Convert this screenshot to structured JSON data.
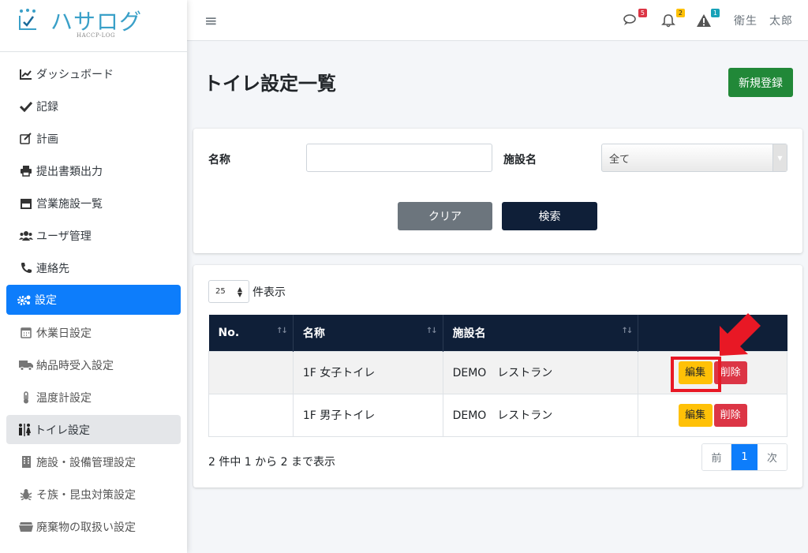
{
  "brand": {
    "name": "ハサログ",
    "sub": "HACCP-LOG"
  },
  "header": {
    "messages_badge": "5",
    "notifications_badge": "2",
    "alerts_badge": "1",
    "user_name": "衛生　太郎"
  },
  "sidebar": {
    "items": [
      {
        "label": "ダッシュボード",
        "icon": "chart-line-icon"
      },
      {
        "label": "記録",
        "icon": "check-icon"
      },
      {
        "label": "計画",
        "icon": "edit-icon"
      },
      {
        "label": "提出書類出力",
        "icon": "print-icon"
      },
      {
        "label": "営業施設一覧",
        "icon": "store-icon"
      },
      {
        "label": "ユーザ管理",
        "icon": "users-icon"
      },
      {
        "label": "連絡先",
        "icon": "phone-icon"
      },
      {
        "label": "設定",
        "icon": "cogs-icon"
      },
      {
        "label": "休業日設定",
        "icon": "calendar-icon"
      },
      {
        "label": "納品時受入設定",
        "icon": "truck-icon"
      },
      {
        "label": "温度計設定",
        "icon": "thermometer-icon"
      },
      {
        "label": "トイレ設定",
        "icon": "restroom-icon"
      },
      {
        "label": "施設・設備管理設定",
        "icon": "building-icon"
      },
      {
        "label": "そ族・昆虫対策設定",
        "icon": "bug-icon"
      },
      {
        "label": "廃棄物の取扱い設定",
        "icon": "dumpster-icon"
      }
    ]
  },
  "page": {
    "title": "トイレ設定一覧",
    "new_button": "新規登録"
  },
  "search": {
    "name_label": "名称",
    "name_value": "",
    "facility_label": "施設名",
    "facility_selected": "全て",
    "clear_button": "クリア",
    "search_button": "検索"
  },
  "list": {
    "page_length": "25",
    "page_length_label": "件表示",
    "columns": [
      "No.",
      "名称",
      "施設名",
      ""
    ],
    "rows": [
      {
        "no": "",
        "name": "1F 女子トイレ",
        "facility": "DEMO　レストラン",
        "edit": "編集",
        "delete": "削除"
      },
      {
        "no": "",
        "name": "1F 男子トイレ",
        "facility": "DEMO　レストラン",
        "edit": "編集",
        "delete": "削除"
      }
    ],
    "info": "2 件中 1 から 2 まで表示",
    "pager": {
      "prev": "前",
      "current": "1",
      "next": "次"
    }
  },
  "colors": {
    "primary": "#0d7dfb",
    "navy": "#0f1f38",
    "success": "#218838",
    "warning": "#ffc107",
    "danger": "#dc3545",
    "annotation": "#e81825"
  }
}
